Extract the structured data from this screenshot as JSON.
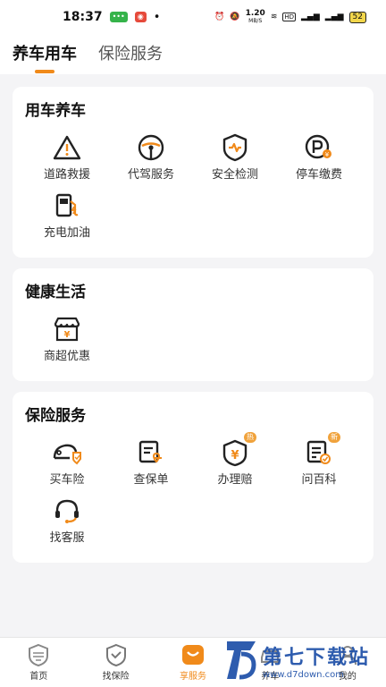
{
  "status_bar": {
    "time": "18:37",
    "speed": "1.20",
    "speed_unit": "MB/S",
    "battery": "52"
  },
  "tabs": [
    {
      "label": "养车用车",
      "active": true
    },
    {
      "label": "保险服务",
      "active": false
    }
  ],
  "sections": [
    {
      "title": "用车养车",
      "items": [
        {
          "label": "道路救援",
          "icon": "warning-icon"
        },
        {
          "label": "代驾服务",
          "icon": "steering-wheel-icon"
        },
        {
          "label": "安全检测",
          "icon": "shield-pulse-icon"
        },
        {
          "label": "停车缴费",
          "icon": "parking-coin-icon"
        },
        {
          "label": "充电加油",
          "icon": "fuel-pump-icon"
        }
      ]
    },
    {
      "title": "健康生活",
      "items": [
        {
          "label": "商超优惠",
          "icon": "store-icon"
        }
      ]
    },
    {
      "title": "保险服务",
      "items": [
        {
          "label": "买车险",
          "icon": "car-insurance-icon"
        },
        {
          "label": "查保单",
          "icon": "policy-icon"
        },
        {
          "label": "办理赔",
          "icon": "claim-icon",
          "badge": "热"
        },
        {
          "label": "问百科",
          "icon": "wiki-icon",
          "badge": "新"
        },
        {
          "label": "找客服",
          "icon": "headset-icon"
        }
      ]
    }
  ],
  "bottom_nav": [
    {
      "label": "首页",
      "icon": "shield-home-icon",
      "active": false
    },
    {
      "label": "找保险",
      "icon": "shield-check-icon",
      "active": false
    },
    {
      "label": "享服务",
      "icon": "service-icon",
      "active": true
    },
    {
      "label": "养车",
      "icon": "car-icon",
      "active": false
    },
    {
      "label": "我的",
      "icon": "profile-icon",
      "active": false
    }
  ],
  "watermark": {
    "title": "第七下载站",
    "url": "www.d7down.com"
  },
  "colors": {
    "accent": "#f08a1a",
    "background": "#f4f4f6"
  }
}
